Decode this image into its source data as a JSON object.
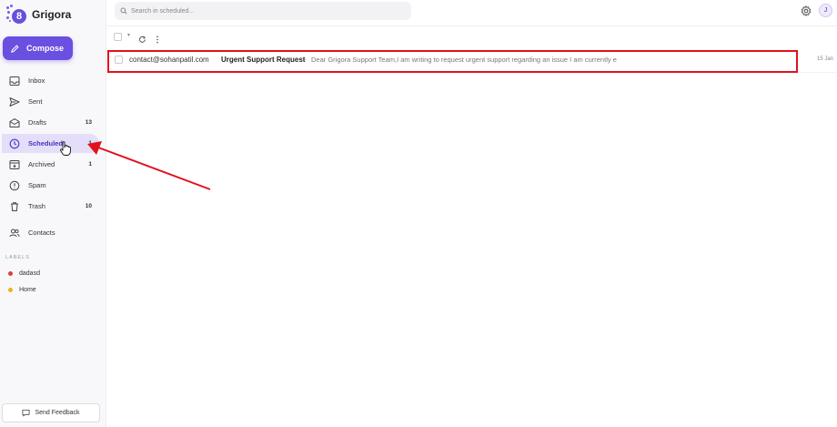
{
  "app": {
    "name": "Grigora",
    "logo_glyph": "8"
  },
  "compose": {
    "label": "Compose"
  },
  "nav": {
    "items": [
      {
        "id": "inbox",
        "label": "Inbox",
        "count": "",
        "icon": "inbox-icon"
      },
      {
        "id": "sent",
        "label": "Sent",
        "count": "",
        "icon": "send-icon"
      },
      {
        "id": "drafts",
        "label": "Drafts",
        "count": "13",
        "icon": "envelope-icon"
      },
      {
        "id": "scheduled",
        "label": "Scheduled",
        "count": "1",
        "icon": "clock-icon",
        "active": true
      },
      {
        "id": "archived",
        "label": "Archived",
        "count": "1",
        "icon": "archive-icon"
      },
      {
        "id": "spam",
        "label": "Spam",
        "count": "",
        "icon": "alert-icon"
      },
      {
        "id": "trash",
        "label": "Trash",
        "count": "10",
        "icon": "trash-icon"
      },
      {
        "id": "contacts",
        "label": "Contacts",
        "count": "",
        "icon": "users-icon"
      }
    ]
  },
  "labels": {
    "heading": "LABELS",
    "items": [
      {
        "label": "dadasd",
        "color": "#d9413a"
      },
      {
        "label": "Home",
        "color": "#e6b422"
      }
    ]
  },
  "feedback": {
    "label": "Send Feedback"
  },
  "search": {
    "placeholder": "Search in scheduled..."
  },
  "user": {
    "initial": "J"
  },
  "mail": {
    "rows": [
      {
        "sender": "contact@sohanpatil.com",
        "subject": "Urgent Support Request",
        "separator": "-",
        "snippet": "Dear Grigora Support Team,I am writing to request urgent support regarding an issue I am currently e",
        "date": "15 Jan"
      }
    ]
  },
  "colors": {
    "accent": "#6b4fe0",
    "highlight": "#e0121c"
  }
}
